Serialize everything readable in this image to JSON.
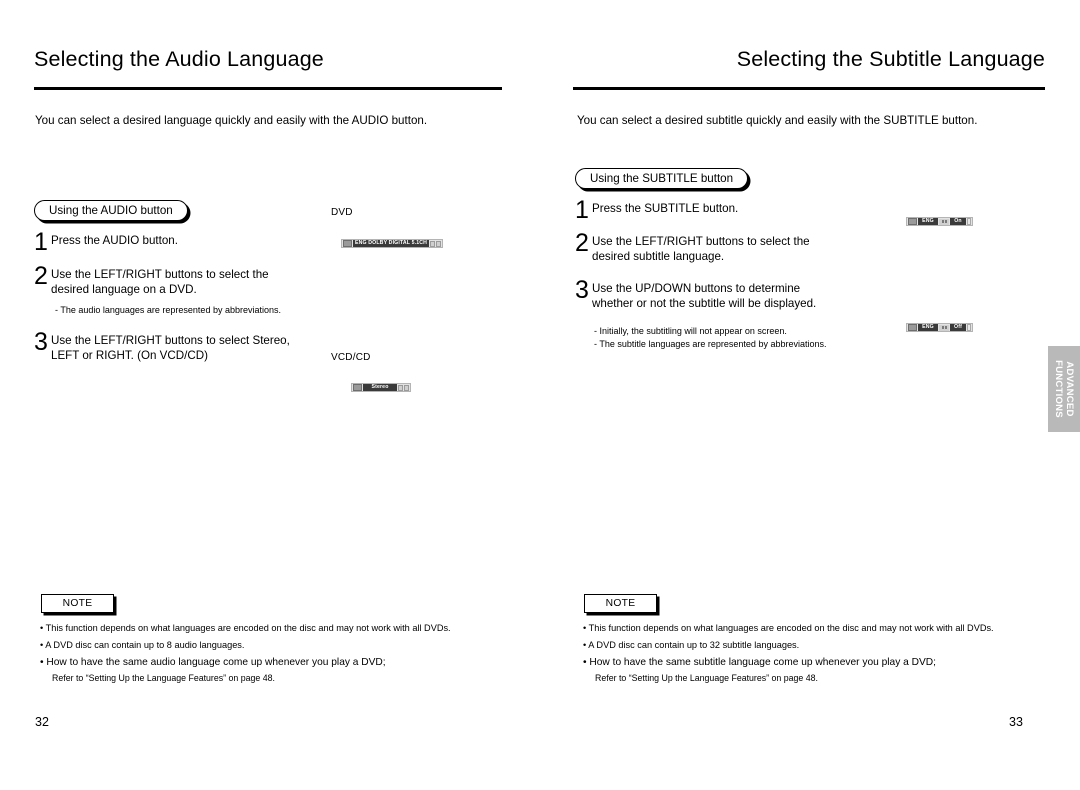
{
  "left_page": {
    "title": "Selecting the Audio Language",
    "intro": "You can select a desired language quickly and easily with the AUDIO button.",
    "section_pill": "Using the AUDIO button",
    "steps": [
      {
        "num": "1",
        "lines": [
          "Press the AUDIO button."
        ]
      },
      {
        "num": "2",
        "lines": [
          "Use the LEFT/RIGHT buttons to select the",
          "desired language on a DVD."
        ]
      },
      {
        "num": "3",
        "lines": [
          "Use the LEFT/RIGHT buttons to select Stereo,",
          "LEFT or RIGHT. (On VCD/CD)"
        ]
      }
    ],
    "subnote": "- The audio languages are represented by abbreviations.",
    "disc_label_dvd": "DVD",
    "disc_label_vcdcd": "VCD/CD",
    "osd_dvd_text": "ENG  DOLBY DIGITAL  5.1CH",
    "osd_vcd_text": "Stereo",
    "note": {
      "label": "NOTE",
      "items": [
        "• This function depends on what languages are encoded on the disc and may not work with all DVDs.",
        "• A DVD disc can contain up to 8 audio languages.",
        "• How to have the same audio language come up whenever you play  a DVD;"
      ],
      "sub": "Refer to “Setting Up the Language Features” on page 48."
    },
    "page_number": "32"
  },
  "right_page": {
    "title": "Selecting the Subtitle Language",
    "intro": "You can select a desired subtitle quickly and easily with the SUBTITLE button.",
    "section_pill": "Using the SUBTITLE button",
    "steps": [
      {
        "num": "1",
        "lines": [
          "Press the SUBTITLE button."
        ]
      },
      {
        "num": "2",
        "lines": [
          "Use the LEFT/RIGHT buttons to select the",
          "desired subtitle language."
        ]
      },
      {
        "num": "3",
        "lines": [
          "Use the UP/DOWN buttons to determine",
          "whether or not the subtitle will be displayed."
        ]
      }
    ],
    "subnotes": [
      "- Initially, the subtitling will not appear on screen.",
      "- The subtitle languages are represented by abbreviations."
    ],
    "osd_lang": "ENG",
    "osd_state_on": "On",
    "osd_state_off": "Off",
    "note": {
      "label": "NOTE",
      "items": [
        "• This function depends on what languages are encoded on the disc and may not work with all DVDs.",
        "• A DVD disc can contain up to 32 subtitle languages.",
        "• How to have the same subtitle language come up whenever you play  a DVD;"
      ],
      "sub": "Refer to “Setting Up the Language Features” on page 48."
    },
    "page_number": "33"
  },
  "side_tab": {
    "line1": "ADVANCED",
    "line2": "FUNCTIONS"
  },
  "colors": {
    "ink": "#000000",
    "paper": "#ffffff",
    "tab_gray": "#b9b9b9",
    "osd_bg": "#e3e3e3",
    "osd_dark": "#3a3a3a"
  }
}
